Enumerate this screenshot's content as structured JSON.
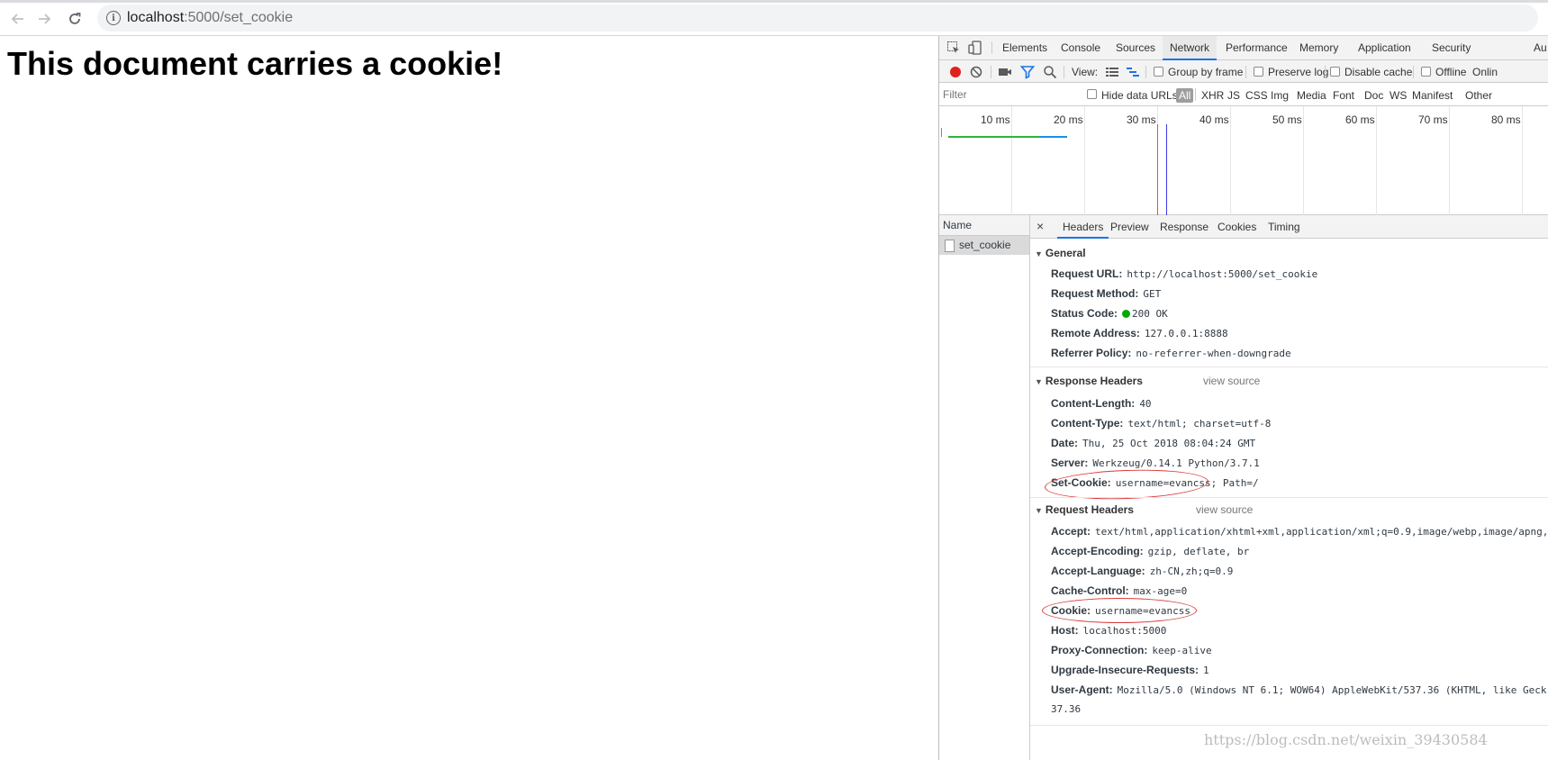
{
  "browser": {
    "url_host": "localhost",
    "url_path": ":5000/set_cookie",
    "icons": [
      "back-icon",
      "forward-icon",
      "reload-icon",
      "info-icon"
    ]
  },
  "page": {
    "heading": "This document carries a cookie!"
  },
  "devtools": {
    "tabs": [
      "Elements",
      "Console",
      "Sources",
      "Network",
      "Performance",
      "Memory",
      "Application",
      "Security",
      "Au"
    ],
    "active_tab": "Network",
    "toolbar": {
      "view_label": "View:",
      "group_by_frame": "Group by frame",
      "preserve_log": "Preserve log",
      "disable_cache": "Disable cache",
      "offline": "Offline",
      "online": "Onlin"
    },
    "filter": {
      "placeholder": "Filter",
      "hide_data_urls": "Hide data URLs",
      "types": [
        "All",
        "XHR",
        "JS",
        "CSS",
        "Img",
        "Media",
        "Font",
        "Doc",
        "WS",
        "Manifest",
        "Other"
      ]
    },
    "overview": {
      "ticks": [
        "10 ms",
        "20 ms",
        "30 ms",
        "40 ms",
        "50 ms",
        "60 ms",
        "70 ms",
        "80 ms"
      ]
    },
    "requests": {
      "header": "Name",
      "items": [
        "set_cookie"
      ]
    },
    "detail": {
      "close": "×",
      "tabs": [
        "Headers",
        "Preview",
        "Response",
        "Cookies",
        "Timing"
      ],
      "active_tab": "Headers",
      "general": {
        "title": "General",
        "rows": [
          {
            "k": "Request URL:",
            "v": "http://localhost:5000/set_cookie"
          },
          {
            "k": "Request Method:",
            "v": "GET"
          },
          {
            "k": "Status Code:",
            "v": "200 OK"
          },
          {
            "k": "Remote Address:",
            "v": "127.0.0.1:8888"
          },
          {
            "k": "Referrer Policy:",
            "v": "no-referrer-when-downgrade"
          }
        ]
      },
      "response_headers": {
        "title": "Response Headers",
        "view_source": "view source",
        "rows": [
          {
            "k": "Content-Length:",
            "v": "40"
          },
          {
            "k": "Content-Type:",
            "v": "text/html; charset=utf-8"
          },
          {
            "k": "Date:",
            "v": "Thu, 25 Oct 2018 08:04:24 GMT"
          },
          {
            "k": "Server:",
            "v": "Werkzeug/0.14.1 Python/3.7.1"
          },
          {
            "k": "Set-Cookie:",
            "v": "username=evancss; Path=/"
          }
        ]
      },
      "request_headers": {
        "title": "Request Headers",
        "view_source": "view source",
        "rows": [
          {
            "k": "Accept:",
            "v": "text/html,application/xhtml+xml,application/xml;q=0.9,image/webp,image/apng,"
          },
          {
            "k": "Accept-Encoding:",
            "v": "gzip, deflate, br"
          },
          {
            "k": "Accept-Language:",
            "v": "zh-CN,zh;q=0.9"
          },
          {
            "k": "Cache-Control:",
            "v": "max-age=0"
          },
          {
            "k": "Cookie:",
            "v": "username=evancss"
          },
          {
            "k": "Host:",
            "v": "localhost:5000"
          },
          {
            "k": "Proxy-Connection:",
            "v": "keep-alive"
          },
          {
            "k": "Upgrade-Insecure-Requests:",
            "v": "1"
          },
          {
            "k": "User-Agent:",
            "v": "Mozilla/5.0 (Windows NT 6.1; WOW64) AppleWebKit/537.36 (KHTML, like Geck"
          }
        ],
        "continuation": "37.36"
      }
    }
  },
  "watermark": "https://blog.csdn.net/weixin_39430584",
  "colors": {
    "accent": "#1a73e8",
    "record": "#e0201c",
    "status_ok": "#00aa00",
    "annotation": "#d93a3a"
  }
}
